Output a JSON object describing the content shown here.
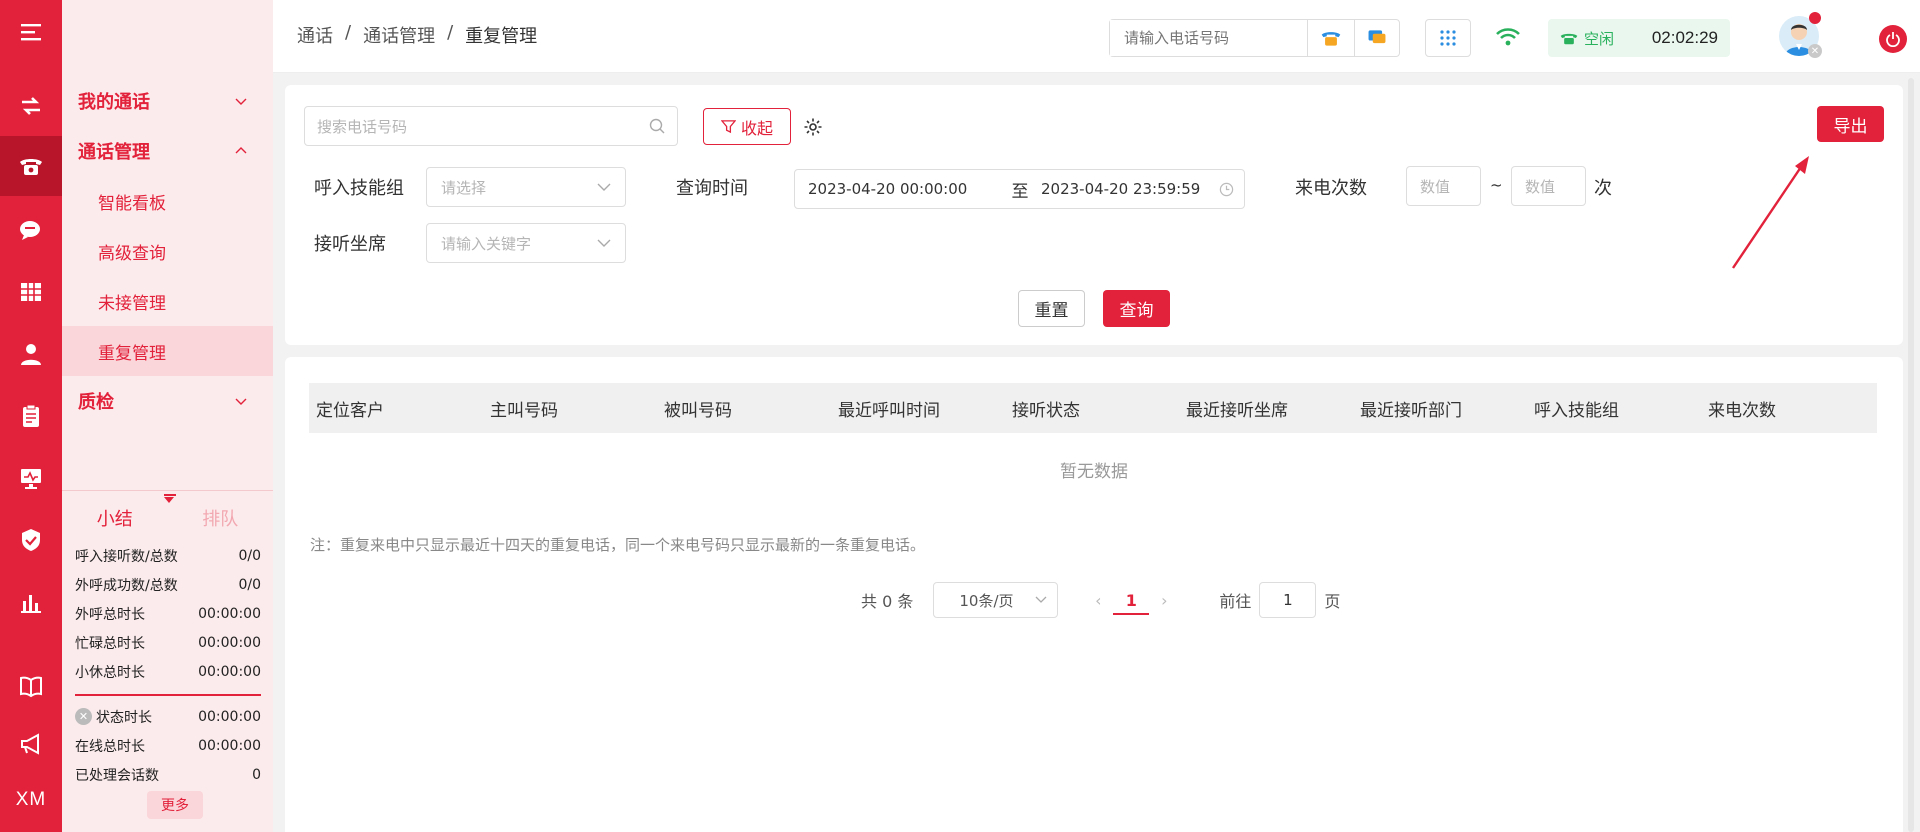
{
  "rail": {
    "bottom_text": "XM"
  },
  "subnav": {
    "groups": [
      {
        "label": "我的通话"
      },
      {
        "label": "通话管理"
      },
      {
        "label": "质检"
      }
    ],
    "items": [
      {
        "label": "智能看板"
      },
      {
        "label": "高级查询"
      },
      {
        "label": "未接管理"
      },
      {
        "label": "重复管理"
      }
    ]
  },
  "summary": {
    "tab_active": "小结",
    "tab_inactive": "排队",
    "stats": [
      {
        "label": "呼入接听数/总数",
        "value": "0/0"
      },
      {
        "label": "外呼成功数/总数",
        "value": "0/0"
      },
      {
        "label": "外呼总时长",
        "value": "00:00:00"
      },
      {
        "label": "忙碌总时长",
        "value": "00:00:00"
      },
      {
        "label": "小休总时长",
        "value": "00:00:00"
      },
      {
        "label": "状态时长",
        "value": "00:00:00"
      },
      {
        "label": "在线总时长",
        "value": "00:00:00"
      },
      {
        "label": "已处理会话数",
        "value": "0"
      }
    ],
    "more": "更多"
  },
  "header": {
    "breadcrumb": [
      "通话",
      "通话管理",
      "重复管理"
    ],
    "breadcrumb_sep": "/",
    "phone_placeholder": "请输入电话号码",
    "status": "空闲",
    "timer": "02:02:29"
  },
  "filters": {
    "search_placeholder": "搜索电话号码",
    "collapse_label": "收起",
    "export_label": "导出",
    "skill_group_label": "呼入技能组",
    "skill_group_placeholder": "请选择",
    "query_time_label": "查询时间",
    "date_start": "2023-04-20 00:00:00",
    "date_to": "至",
    "date_end": "2023-04-20 23:59:59",
    "call_count_label": "来电次数",
    "num_placeholder": "数值",
    "tilde": "~",
    "unit": "次",
    "agent_label": "接听坐席",
    "agent_placeholder": "请输入关键字",
    "reset_label": "重置",
    "query_label": "查询"
  },
  "table": {
    "columns": [
      "定位客户",
      "主叫号码",
      "被叫号码",
      "最近呼叫时间",
      "接听状态",
      "最近接听坐席",
      "最近接听部门",
      "呼入技能组",
      "来电次数"
    ],
    "empty_text": "暂无数据",
    "note": "注：重复来电中只显示最近十四天的重复电话，同一个来电号码只显示最新的一条重复电话。"
  },
  "pagination": {
    "total": "共 0 条",
    "page_size": "10条/页",
    "current_page": "1",
    "goto_label": "前往",
    "goto_value": "1",
    "page_suffix": "页"
  },
  "colors": {
    "brand": "#e2213a",
    "status_green": "#2ab15c"
  }
}
